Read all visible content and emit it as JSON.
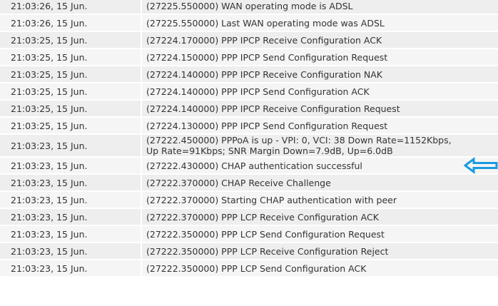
{
  "log": {
    "entries": [
      {
        "time": "21:03:26, 15 Jun.",
        "message": "(27225.550000) WAN operating mode is ADSL"
      },
      {
        "time": "21:03:26, 15 Jun.",
        "message": "(27225.550000) Last WAN operating mode was ADSL"
      },
      {
        "time": "21:03:25, 15 Jun.",
        "message": "(27224.170000) PPP IPCP Receive Configuration ACK"
      },
      {
        "time": "21:03:25, 15 Jun.",
        "message": "(27224.150000) PPP IPCP Send Configuration Request"
      },
      {
        "time": "21:03:25, 15 Jun.",
        "message": "(27224.140000) PPP IPCP Receive Configuration NAK"
      },
      {
        "time": "21:03:25, 15 Jun.",
        "message": "(27224.140000) PPP IPCP Send Configuration ACK"
      },
      {
        "time": "21:03:25, 15 Jun.",
        "message": "(27224.140000) PPP IPCP Receive Configuration Request"
      },
      {
        "time": "21:03:25, 15 Jun.",
        "message": "(27224.130000) PPP IPCP Send Configuration Request"
      },
      {
        "time": "21:03:23, 15 Jun.",
        "message": "(27222.450000) PPPoA is up - VPI: 0, VCI: 38 Down Rate=1152Kbps, Up Rate=91Kbps; SNR Margin Down=7.9dB, Up=6.0dB"
      },
      {
        "time": "21:03:23, 15 Jun.",
        "message": "(27222.430000) CHAP authentication successful"
      },
      {
        "time": "21:03:23, 15 Jun.",
        "message": "(27222.370000) CHAP Receive Challenge"
      },
      {
        "time": "21:03:23, 15 Jun.",
        "message": "(27222.370000) Starting CHAP authentication with peer"
      },
      {
        "time": "21:03:23, 15 Jun.",
        "message": "(27222.370000) PPP LCP Receive Configuration ACK"
      },
      {
        "time": "21:03:23, 15 Jun.",
        "message": "(27222.350000) PPP LCP Send Configuration Request"
      },
      {
        "time": "21:03:23, 15 Jun.",
        "message": "(27222.350000) PPP LCP Receive Configuration Reject"
      },
      {
        "time": "21:03:23, 15 Jun.",
        "message": "(27222.350000) PPP LCP Send Configuration ACK"
      }
    ]
  },
  "annotation": {
    "icon": "left-arrow-icon",
    "color": "#1a9be0"
  }
}
